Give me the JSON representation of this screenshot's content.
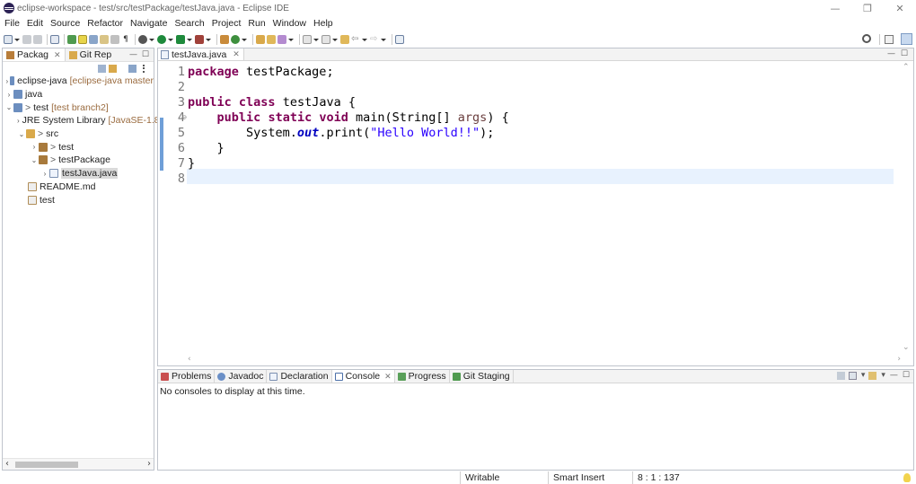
{
  "window": {
    "title": "eclipse-workspace - test/src/testPackage/testJava.java - Eclipse IDE",
    "minimize": "—",
    "restore": "❐",
    "close": "✕"
  },
  "menu": [
    "File",
    "Edit",
    "Source",
    "Refactor",
    "Navigate",
    "Search",
    "Project",
    "Run",
    "Window",
    "Help"
  ],
  "left_panel": {
    "tabs": [
      {
        "label": "Packag",
        "active": true
      },
      {
        "label": "Git Rep",
        "active": false
      }
    ],
    "tree": [
      {
        "indent": 0,
        "twisty": "›",
        "label": "eclipse-java",
        "decoration": "[eclipse-java master",
        "prefix": ""
      },
      {
        "indent": 0,
        "twisty": "›",
        "label": "java",
        "decoration": "",
        "prefix": ""
      },
      {
        "indent": 0,
        "twisty": "⌄",
        "label": "test",
        "decoration": "[test branch2]",
        "prefix": ">"
      },
      {
        "indent": 1,
        "twisty": "›",
        "label": "JRE System Library",
        "decoration": "[JavaSE-1.8",
        "prefix": ""
      },
      {
        "indent": 1,
        "twisty": "⌄",
        "label": "src",
        "decoration": "",
        "prefix": ">"
      },
      {
        "indent": 2,
        "twisty": "›",
        "label": "test",
        "decoration": "",
        "prefix": ">"
      },
      {
        "indent": 2,
        "twisty": "⌄",
        "label": "testPackage",
        "decoration": "",
        "prefix": ">"
      },
      {
        "indent": 3,
        "twisty": "›",
        "label": "testJava.java",
        "decoration": "",
        "prefix": "",
        "selected": true
      },
      {
        "indent": 1,
        "twisty": "",
        "label": "README.md",
        "decoration": "",
        "prefix": ""
      },
      {
        "indent": 1,
        "twisty": "",
        "label": "test",
        "decoration": "",
        "prefix": ""
      }
    ]
  },
  "editor": {
    "tab_label": "testJava.java",
    "line_numbers": [
      "1",
      "2",
      "3",
      "4",
      "5",
      "6",
      "7",
      "8"
    ],
    "code": {
      "l1_kw": "package",
      "l1_rest": " testPackage;",
      "l3_kw1": "public",
      "l3_kw2": "class",
      "l3_rest": " testJava {",
      "l4_indent": "    ",
      "l4_kw1": "public",
      "l4_kw2": "static",
      "l4_kw3": "void",
      "l4_mid": " main(String[] ",
      "l4_param": "args",
      "l4_end": ") {",
      "l5_pre": "        System.",
      "l5_field": "out",
      "l5_mid": ".print(",
      "l5_str": "\"Hello World!!\"",
      "l5_end": ");",
      "l6": "    }",
      "l7": "}"
    },
    "current_line": 8
  },
  "bottom_panel": {
    "tabs": [
      {
        "label": "Problems",
        "active": false
      },
      {
        "label": "Javadoc",
        "active": false
      },
      {
        "label": "Declaration",
        "active": false
      },
      {
        "label": "Console",
        "active": true
      },
      {
        "label": "Progress",
        "active": false
      },
      {
        "label": "Git Staging",
        "active": false
      }
    ],
    "message": "No consoles to display at this time."
  },
  "status": {
    "writable": "Writable",
    "insert_mode": "Smart Insert",
    "position": "8 : 1 : 137"
  },
  "colors": {
    "keyword": "#7f0055",
    "string": "#2a00ff",
    "field": "#0000c0",
    "current_line": "#e8f2fe",
    "git_decoration": "#9a6b3f"
  }
}
